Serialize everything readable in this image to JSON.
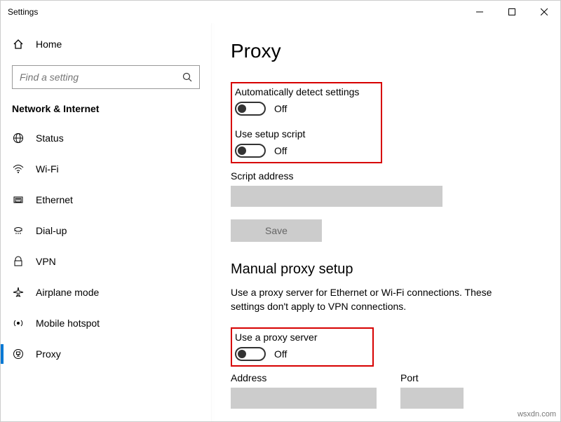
{
  "window": {
    "title": "Settings"
  },
  "sidebar": {
    "home_label": "Home",
    "search_placeholder": "Find a setting",
    "section": "Network & Internet",
    "items": [
      {
        "label": "Status"
      },
      {
        "label": "Wi-Fi"
      },
      {
        "label": "Ethernet"
      },
      {
        "label": "Dial-up"
      },
      {
        "label": "VPN"
      },
      {
        "label": "Airplane mode"
      },
      {
        "label": "Mobile hotspot"
      },
      {
        "label": "Proxy"
      }
    ]
  },
  "page": {
    "title": "Proxy",
    "auto_detect": {
      "label": "Automatically detect settings",
      "state": "Off"
    },
    "setup_script": {
      "label": "Use setup script",
      "state": "Off"
    },
    "script_address_label": "Script address",
    "save_label": "Save",
    "manual_header": "Manual proxy setup",
    "manual_desc": "Use a proxy server for Ethernet or Wi-Fi connections. These settings don't apply to VPN connections.",
    "use_proxy": {
      "label": "Use a proxy server",
      "state": "Off"
    },
    "address_label": "Address",
    "port_label": "Port"
  },
  "watermark": "wsxdn.com"
}
